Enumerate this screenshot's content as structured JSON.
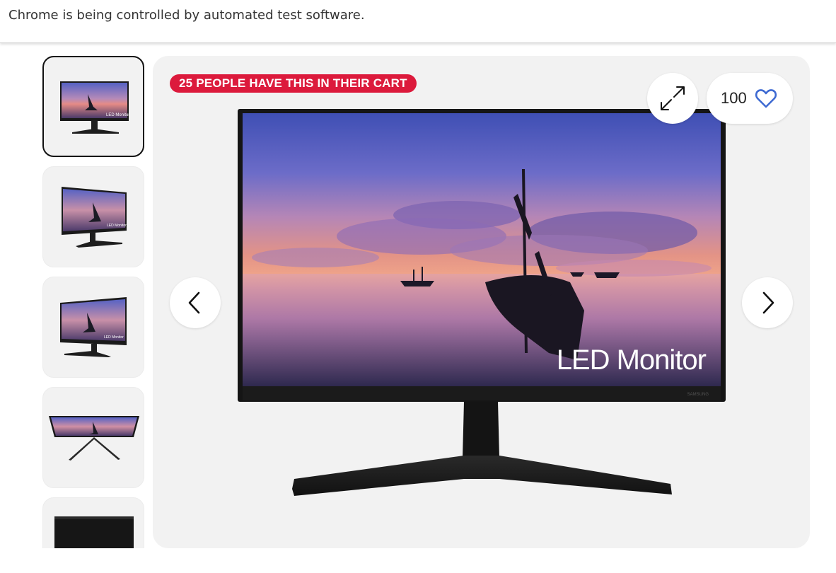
{
  "infobar": {
    "message": "Chrome is being controlled by automated test software."
  },
  "gallery": {
    "thumbnails": [
      {
        "label": "LED Monitor",
        "view": "front",
        "selected": true
      },
      {
        "label": "LED Monitor",
        "view": "angled-left",
        "selected": false
      },
      {
        "label": "LED Monitor",
        "view": "angled-right",
        "selected": false
      },
      {
        "label": "",
        "view": "top-down",
        "selected": false
      },
      {
        "label": "",
        "view": "back",
        "selected": false
      }
    ],
    "badge": {
      "text": "25 PEOPLE HAVE THIS IN THEIR CART",
      "color": "#dc1a3c"
    },
    "main_image": {
      "screen_text": "LED Monitor",
      "brand_text": "SAMSUNG"
    },
    "favorite": {
      "count": "100",
      "icon": "heart-outline-icon",
      "color": "#3e6ad2"
    },
    "expand_icon": "expand-arrows-icon",
    "prev_icon": "chevron-left-icon",
    "next_icon": "chevron-right-icon"
  }
}
